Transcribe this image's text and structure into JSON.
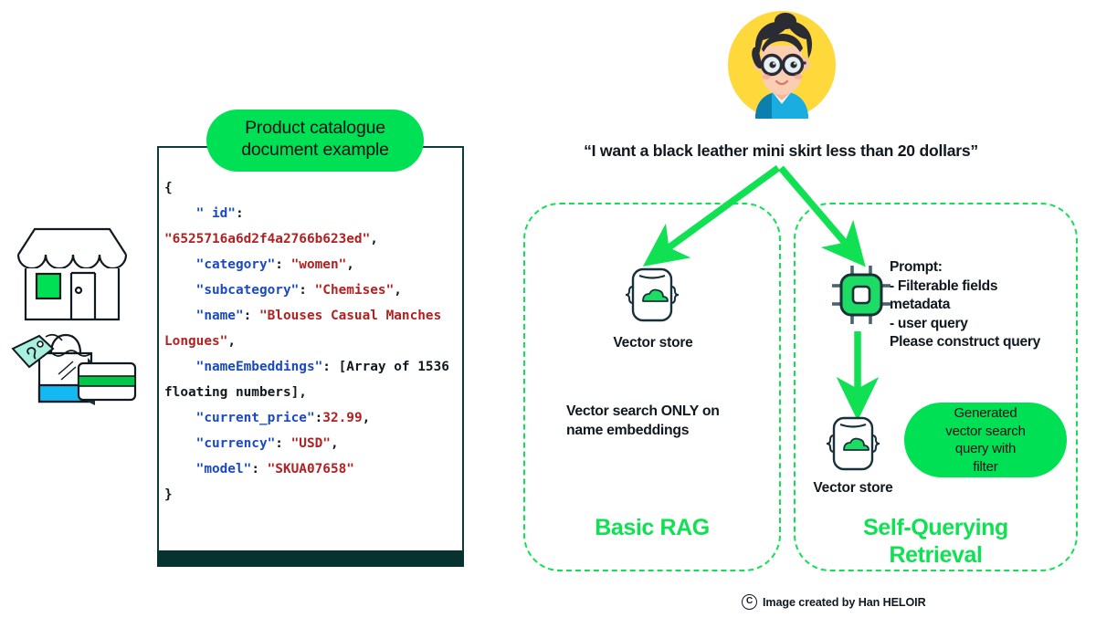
{
  "colors": {
    "green": "#00e055",
    "green_bright": "#0fe152",
    "dark": "#101820",
    "doc_border": "#0c3d38",
    "doc_footer": "#06332f",
    "json_key": "#1a49c4",
    "json_string": "#b32020",
    "avatar_bg": "#ffd93b"
  },
  "left_illustration": {
    "shop_icon_name": "storefront-icon",
    "bag_icon_name": "shopping-bag-icon",
    "tag_icon_name": "price-tag-icon",
    "card_icon_name": "credit-card-icon"
  },
  "document": {
    "badge_label": "Product catalogue\ndocument example",
    "code_lines": [
      [
        {
          "t": "{",
          "c": "pun"
        }
      ],
      [
        {
          "t": "    ",
          "c": "pun"
        },
        {
          "t": "\" id\"",
          "c": "key"
        },
        {
          "t": ":",
          "c": "pun"
        }
      ],
      [
        {
          "t": "\"6525716a6d2f4a2766b623ed\"",
          "c": "str"
        },
        {
          "t": ",",
          "c": "pun"
        }
      ],
      [
        {
          "t": "    ",
          "c": "pun"
        },
        {
          "t": "\"category\"",
          "c": "key"
        },
        {
          "t": ": ",
          "c": "pun"
        },
        {
          "t": "\"women\"",
          "c": "str"
        },
        {
          "t": ",",
          "c": "pun"
        }
      ],
      [
        {
          "t": "    ",
          "c": "pun"
        },
        {
          "t": "\"subcategory\"",
          "c": "key"
        },
        {
          "t": ": ",
          "c": "pun"
        },
        {
          "t": "\"Chemises\"",
          "c": "str"
        },
        {
          "t": ",",
          "c": "pun"
        }
      ],
      [
        {
          "t": "    ",
          "c": "pun"
        },
        {
          "t": "\"name\"",
          "c": "key"
        },
        {
          "t": ": ",
          "c": "pun"
        },
        {
          "t": "\"Blouses Casual Manches Longues\"",
          "c": "str"
        },
        {
          "t": ",",
          "c": "pun"
        }
      ],
      [
        {
          "t": "    ",
          "c": "pun"
        },
        {
          "t": "\"nameEmbeddings\"",
          "c": "key"
        },
        {
          "t": ": [Array of 1536 floating numbers],",
          "c": "pun"
        }
      ],
      [
        {
          "t": "    ",
          "c": "pun"
        },
        {
          "t": "\"current_price\"",
          "c": "key"
        },
        {
          "t": ":",
          "c": "pun"
        },
        {
          "t": "32.99",
          "c": "num"
        },
        {
          "t": ",",
          "c": "pun"
        }
      ],
      [
        {
          "t": "    ",
          "c": "pun"
        },
        {
          "t": "\"currency\"",
          "c": "key"
        },
        {
          "t": ": ",
          "c": "pun"
        },
        {
          "t": "\"USD\"",
          "c": "str"
        },
        {
          "t": ",",
          "c": "pun"
        }
      ],
      [
        {
          "t": "    ",
          "c": "pun"
        },
        {
          "t": "\"model\"",
          "c": "key"
        },
        {
          "t": ": ",
          "c": "pun"
        },
        {
          "t": "\"SKUA07658\"",
          "c": "str"
        }
      ],
      [
        {
          "t": "}",
          "c": "pun"
        }
      ]
    ]
  },
  "user": {
    "avatar_icon_name": "user-avatar-icon",
    "quote": "“I want a black leather mini skirt less than 20 dollars”"
  },
  "panels": {
    "basic_rag": {
      "title": "Basic RAG",
      "vector_store_label": "Vector store",
      "note": "Vector search ONLY on\nname embeddings"
    },
    "self_querying": {
      "title": "Self-Querying\nRetrieval",
      "vector_store_label": "Vector store",
      "prompt": "Prompt:\n- Filterable fields\nmetadata\n- user query\nPlease construct query",
      "generated_query_badge": "Generated\nvector search\nquery with\nfilter"
    }
  },
  "credit": {
    "copyright_glyph": "C",
    "text": "Image created by Han HELOIR"
  }
}
